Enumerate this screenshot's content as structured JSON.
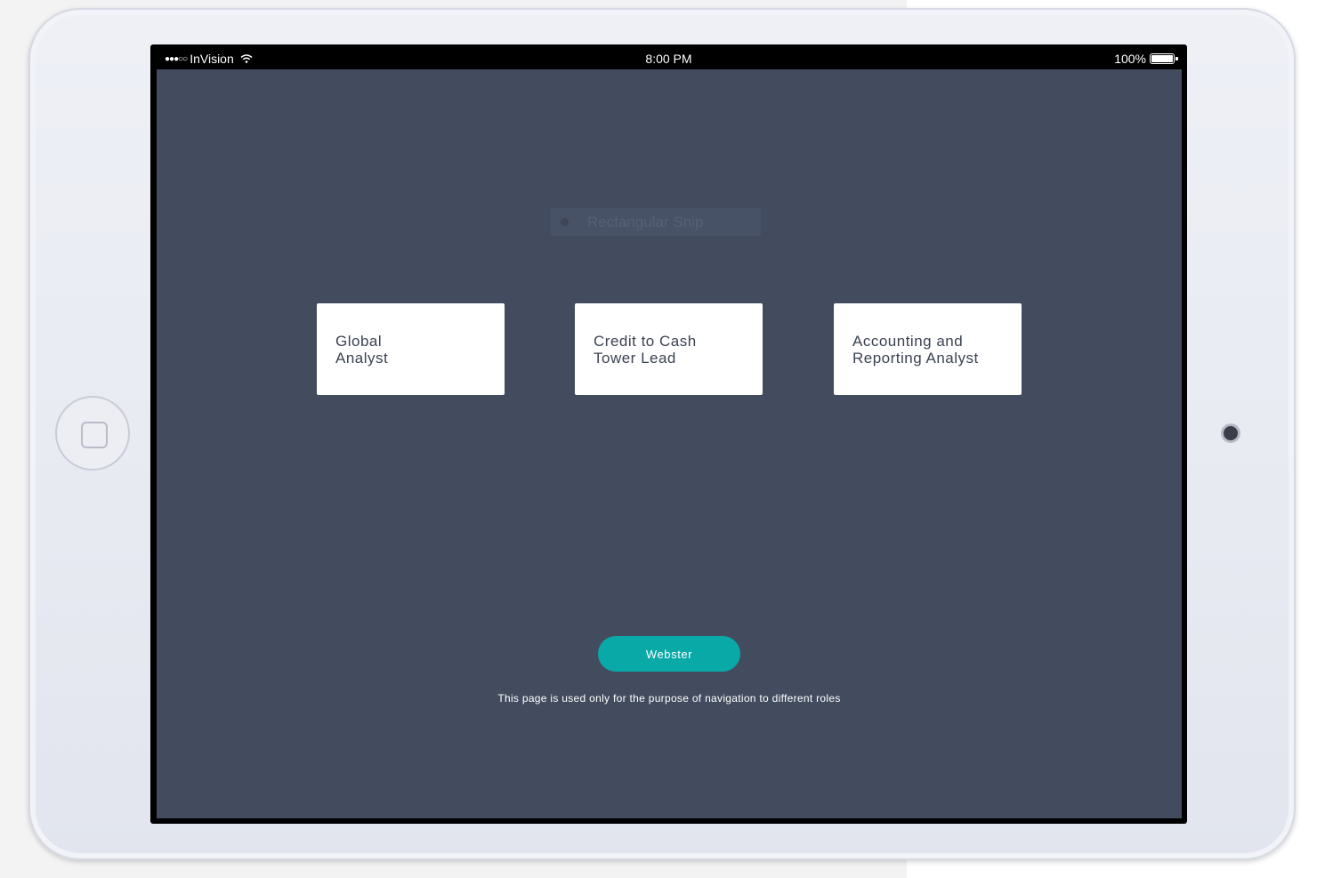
{
  "status_bar": {
    "carrier": "InVision",
    "time": "8:00 PM",
    "battery": "100%",
    "signal_icon": "signal-dots-icon",
    "wifi_icon": "wifi-icon",
    "battery_icon": "battery-icon"
  },
  "overlay": {
    "snip_label": "Rectangular Snip"
  },
  "roles": [
    {
      "label": "Global\nAnalyst"
    },
    {
      "label": "Credit to Cash\nTower Lead"
    },
    {
      "label": "Accounting and\nReporting Analyst"
    }
  ],
  "actions": {
    "webster_label": "Webster"
  },
  "footer": {
    "note": "This page is used only for the purpose of navigation to different roles"
  },
  "colors": {
    "screen_bg": "#434c5f",
    "accent": "#09a9a7",
    "card_bg": "#ffffff",
    "card_text": "#3b4253"
  }
}
